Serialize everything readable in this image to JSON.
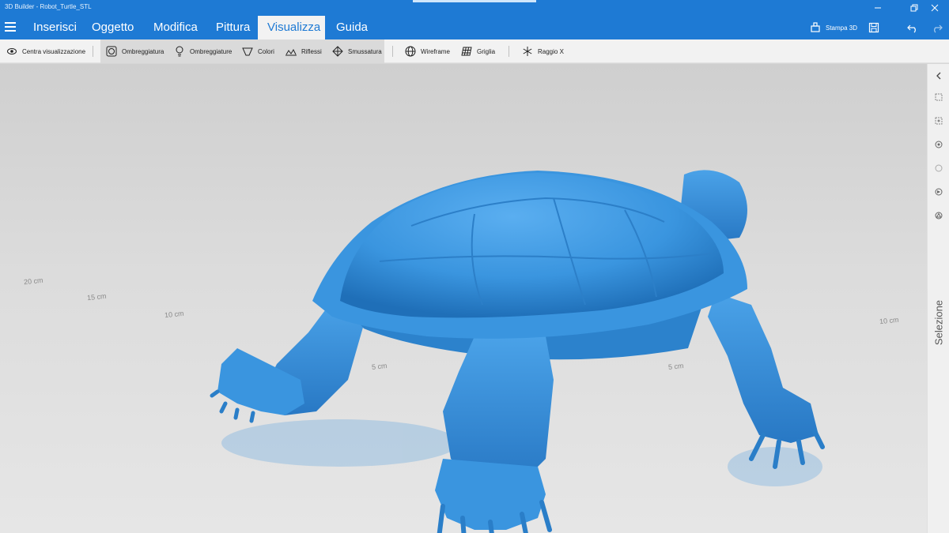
{
  "window": {
    "title": "3D Builder - Robot_Turtle_STL"
  },
  "menu": {
    "tabs": [
      {
        "label": "Inserisci"
      },
      {
        "label": "Oggetto"
      },
      {
        "label": "Modifica"
      },
      {
        "label": "Pittura"
      },
      {
        "label": "Visualizza"
      },
      {
        "label": "Guida"
      }
    ],
    "active_tab": "Visualizza",
    "print_label": "Stampa 3D"
  },
  "ribbon": {
    "center_view": "Centra visualizzazione",
    "shading": "Ombreggiatura",
    "shadows": "Ombreggiature",
    "colors": "Colori",
    "reflections": "Riflessi",
    "smoothing": "Smussatura",
    "wireframe": "Wireframe",
    "grid": "Griglia",
    "xray": "Raggio X"
  },
  "viewport": {
    "grid_labels": [
      "20 cm",
      "15 cm",
      "10 cm",
      "5 cm",
      "5 cm",
      "10 cm"
    ]
  },
  "sidepanel": {
    "label": "Selezione"
  },
  "colors": {
    "accent": "#1e7ad4",
    "model": "#3a95df",
    "viewport_bg": "#d8d8d8"
  }
}
